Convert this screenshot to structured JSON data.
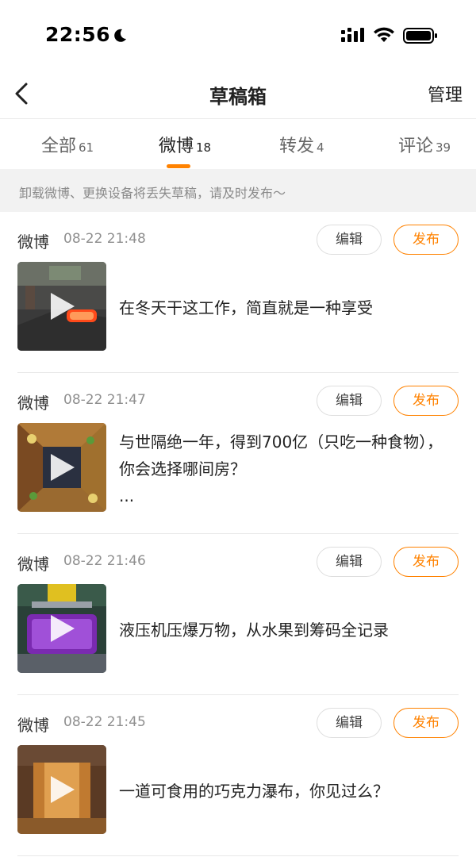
{
  "status_bar": {
    "time": "22:56"
  },
  "nav": {
    "title": "草稿箱",
    "manage_label": "管理"
  },
  "tabs": [
    {
      "label": "全部",
      "count": "61"
    },
    {
      "label": "微博",
      "count": "18",
      "active": true
    },
    {
      "label": "转发",
      "count": "4"
    },
    {
      "label": "评论",
      "count": "39"
    }
  ],
  "notice": "卸载微博、更换设备将丢失草稿，请及时发布～",
  "drafts": [
    {
      "type": "微博",
      "time": "08-22 21:48",
      "edit_label": "编辑",
      "publish_label": "发布",
      "text": "在冬天干这工作，简直就是一种享受"
    },
    {
      "type": "微博",
      "time": "08-22 21:47",
      "edit_label": "编辑",
      "publish_label": "发布",
      "text": "与世隔绝一年，得到700亿（只吃一种食物），你会选择哪间房？",
      "ellipsis": "..."
    },
    {
      "type": "微博",
      "time": "08-22 21:46",
      "edit_label": "编辑",
      "publish_label": "发布",
      "text": "液压机压爆万物，从水果到筹码全记录"
    },
    {
      "type": "微博",
      "time": "08-22 21:45",
      "edit_label": "编辑",
      "publish_label": "发布",
      "text": "一道可食用的巧克力瀑布，你见过么？"
    }
  ],
  "colors": {
    "accent": "#ff8200",
    "divider": "#e8e8e8",
    "notice_bg": "#f2f2f2"
  }
}
